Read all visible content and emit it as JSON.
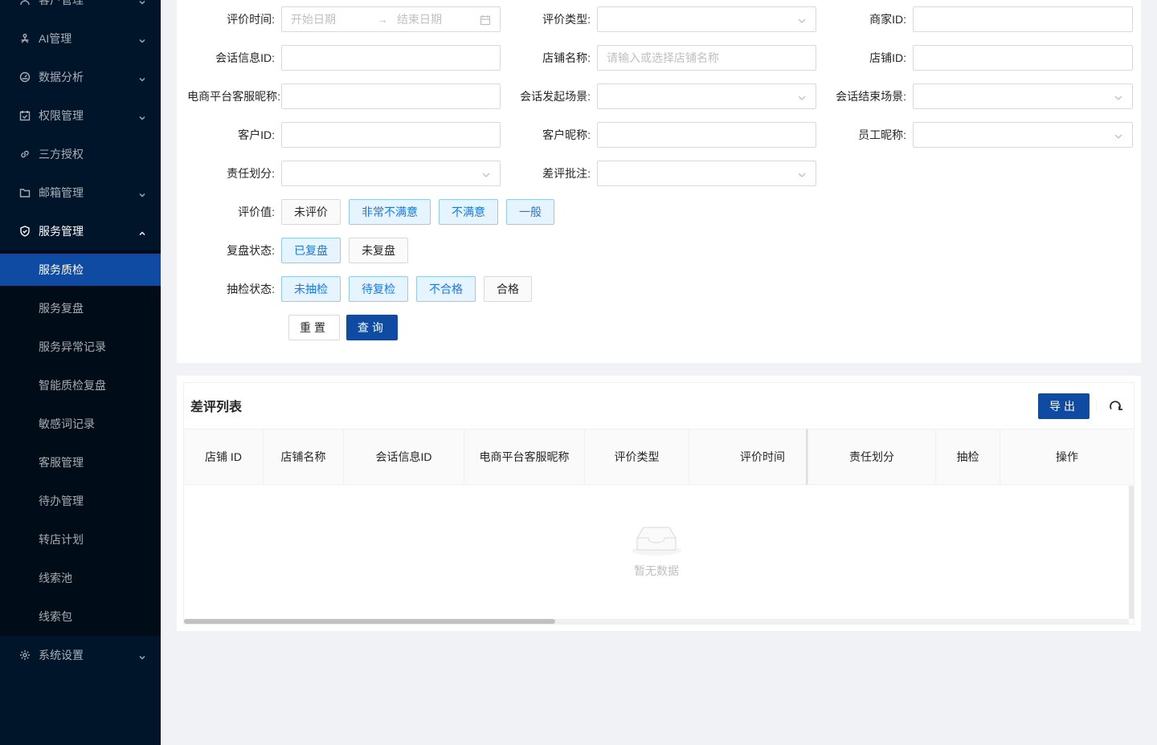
{
  "sidebar": {
    "items": [
      {
        "label": "客户管理",
        "icon": "customer-icon"
      },
      {
        "label": "AI管理",
        "icon": "ai-icon"
      },
      {
        "label": "数据分析",
        "icon": "dashboard-icon"
      },
      {
        "label": "权限管理",
        "icon": "calendar-check-icon"
      },
      {
        "label": "三方授权",
        "icon": "link-icon"
      },
      {
        "label": "邮箱管理",
        "icon": "folder-icon"
      },
      {
        "label": "服务管理",
        "icon": "shield-check-icon"
      },
      {
        "label": "系统设置",
        "icon": "gear-icon"
      }
    ],
    "sub_items": [
      {
        "label": "服务质检",
        "active": true
      },
      {
        "label": "服务复盘"
      },
      {
        "label": "服务异常记录"
      },
      {
        "label": "智能质检复盘"
      },
      {
        "label": "敏感词记录"
      },
      {
        "label": "客服管理"
      },
      {
        "label": "待办管理"
      },
      {
        "label": "转店计划"
      },
      {
        "label": "线索池"
      },
      {
        "label": "线索包"
      }
    ]
  },
  "filters": {
    "eval_time": {
      "label": "评价时间",
      "start_placeholder": "开始日期",
      "separator": "→",
      "end_placeholder": "结束日期"
    },
    "eval_type": {
      "label": "评价类型"
    },
    "merchant_id": {
      "label": "商家ID"
    },
    "session_id": {
      "label": "会话信息ID"
    },
    "shop_name": {
      "label": "店铺名称",
      "placeholder": "请输入或选择店铺名称"
    },
    "shop_id": {
      "label": "店铺ID"
    },
    "platform_nick": {
      "label": "电商平台客服昵称"
    },
    "session_start_scene": {
      "label": "会话发起场景"
    },
    "session_end_scene": {
      "label": "会话结束场景"
    },
    "customer_id": {
      "label": "客户ID"
    },
    "customer_nick": {
      "label": "客户昵称"
    },
    "staff_nick": {
      "label": "员工昵称"
    },
    "responsibility": {
      "label": "责任划分"
    },
    "bad_review_note": {
      "label": "差评批注"
    },
    "eval_value": {
      "label": "评价值",
      "options": [
        {
          "text": "未评价",
          "selected": false
        },
        {
          "text": "非常不满意",
          "selected": true
        },
        {
          "text": "不满意",
          "selected": true
        },
        {
          "text": "一般",
          "selected": true
        }
      ]
    },
    "review_status": {
      "label": "复盘状态",
      "options": [
        {
          "text": "已复盘",
          "selected": true
        },
        {
          "text": "未复盘",
          "selected": false
        }
      ]
    },
    "inspect_status": {
      "label": "抽检状态",
      "options": [
        {
          "text": "未抽检",
          "selected": true
        },
        {
          "text": "待复检",
          "selected": true
        },
        {
          "text": "不合格",
          "selected": true
        },
        {
          "text": "合格",
          "selected": false
        }
      ]
    },
    "colon": ":",
    "reset_label": "重置",
    "query_label": "查询"
  },
  "table": {
    "title": "差评列表",
    "export_label": "导出",
    "columns": [
      "店铺 ID",
      "店铺名称",
      "会话信息ID",
      "电商平台客服昵称",
      "评价类型",
      "评价时间",
      "责任划分",
      "抽检",
      "操作"
    ],
    "empty_text": "暂无数据"
  },
  "colors": {
    "sidebar_bg": "#001529",
    "active_bg": "#0f4aa3",
    "primary": "#0f4aa3",
    "tag_selected_bg": "#e6f4ff",
    "tag_selected_text": "#1677ff"
  }
}
